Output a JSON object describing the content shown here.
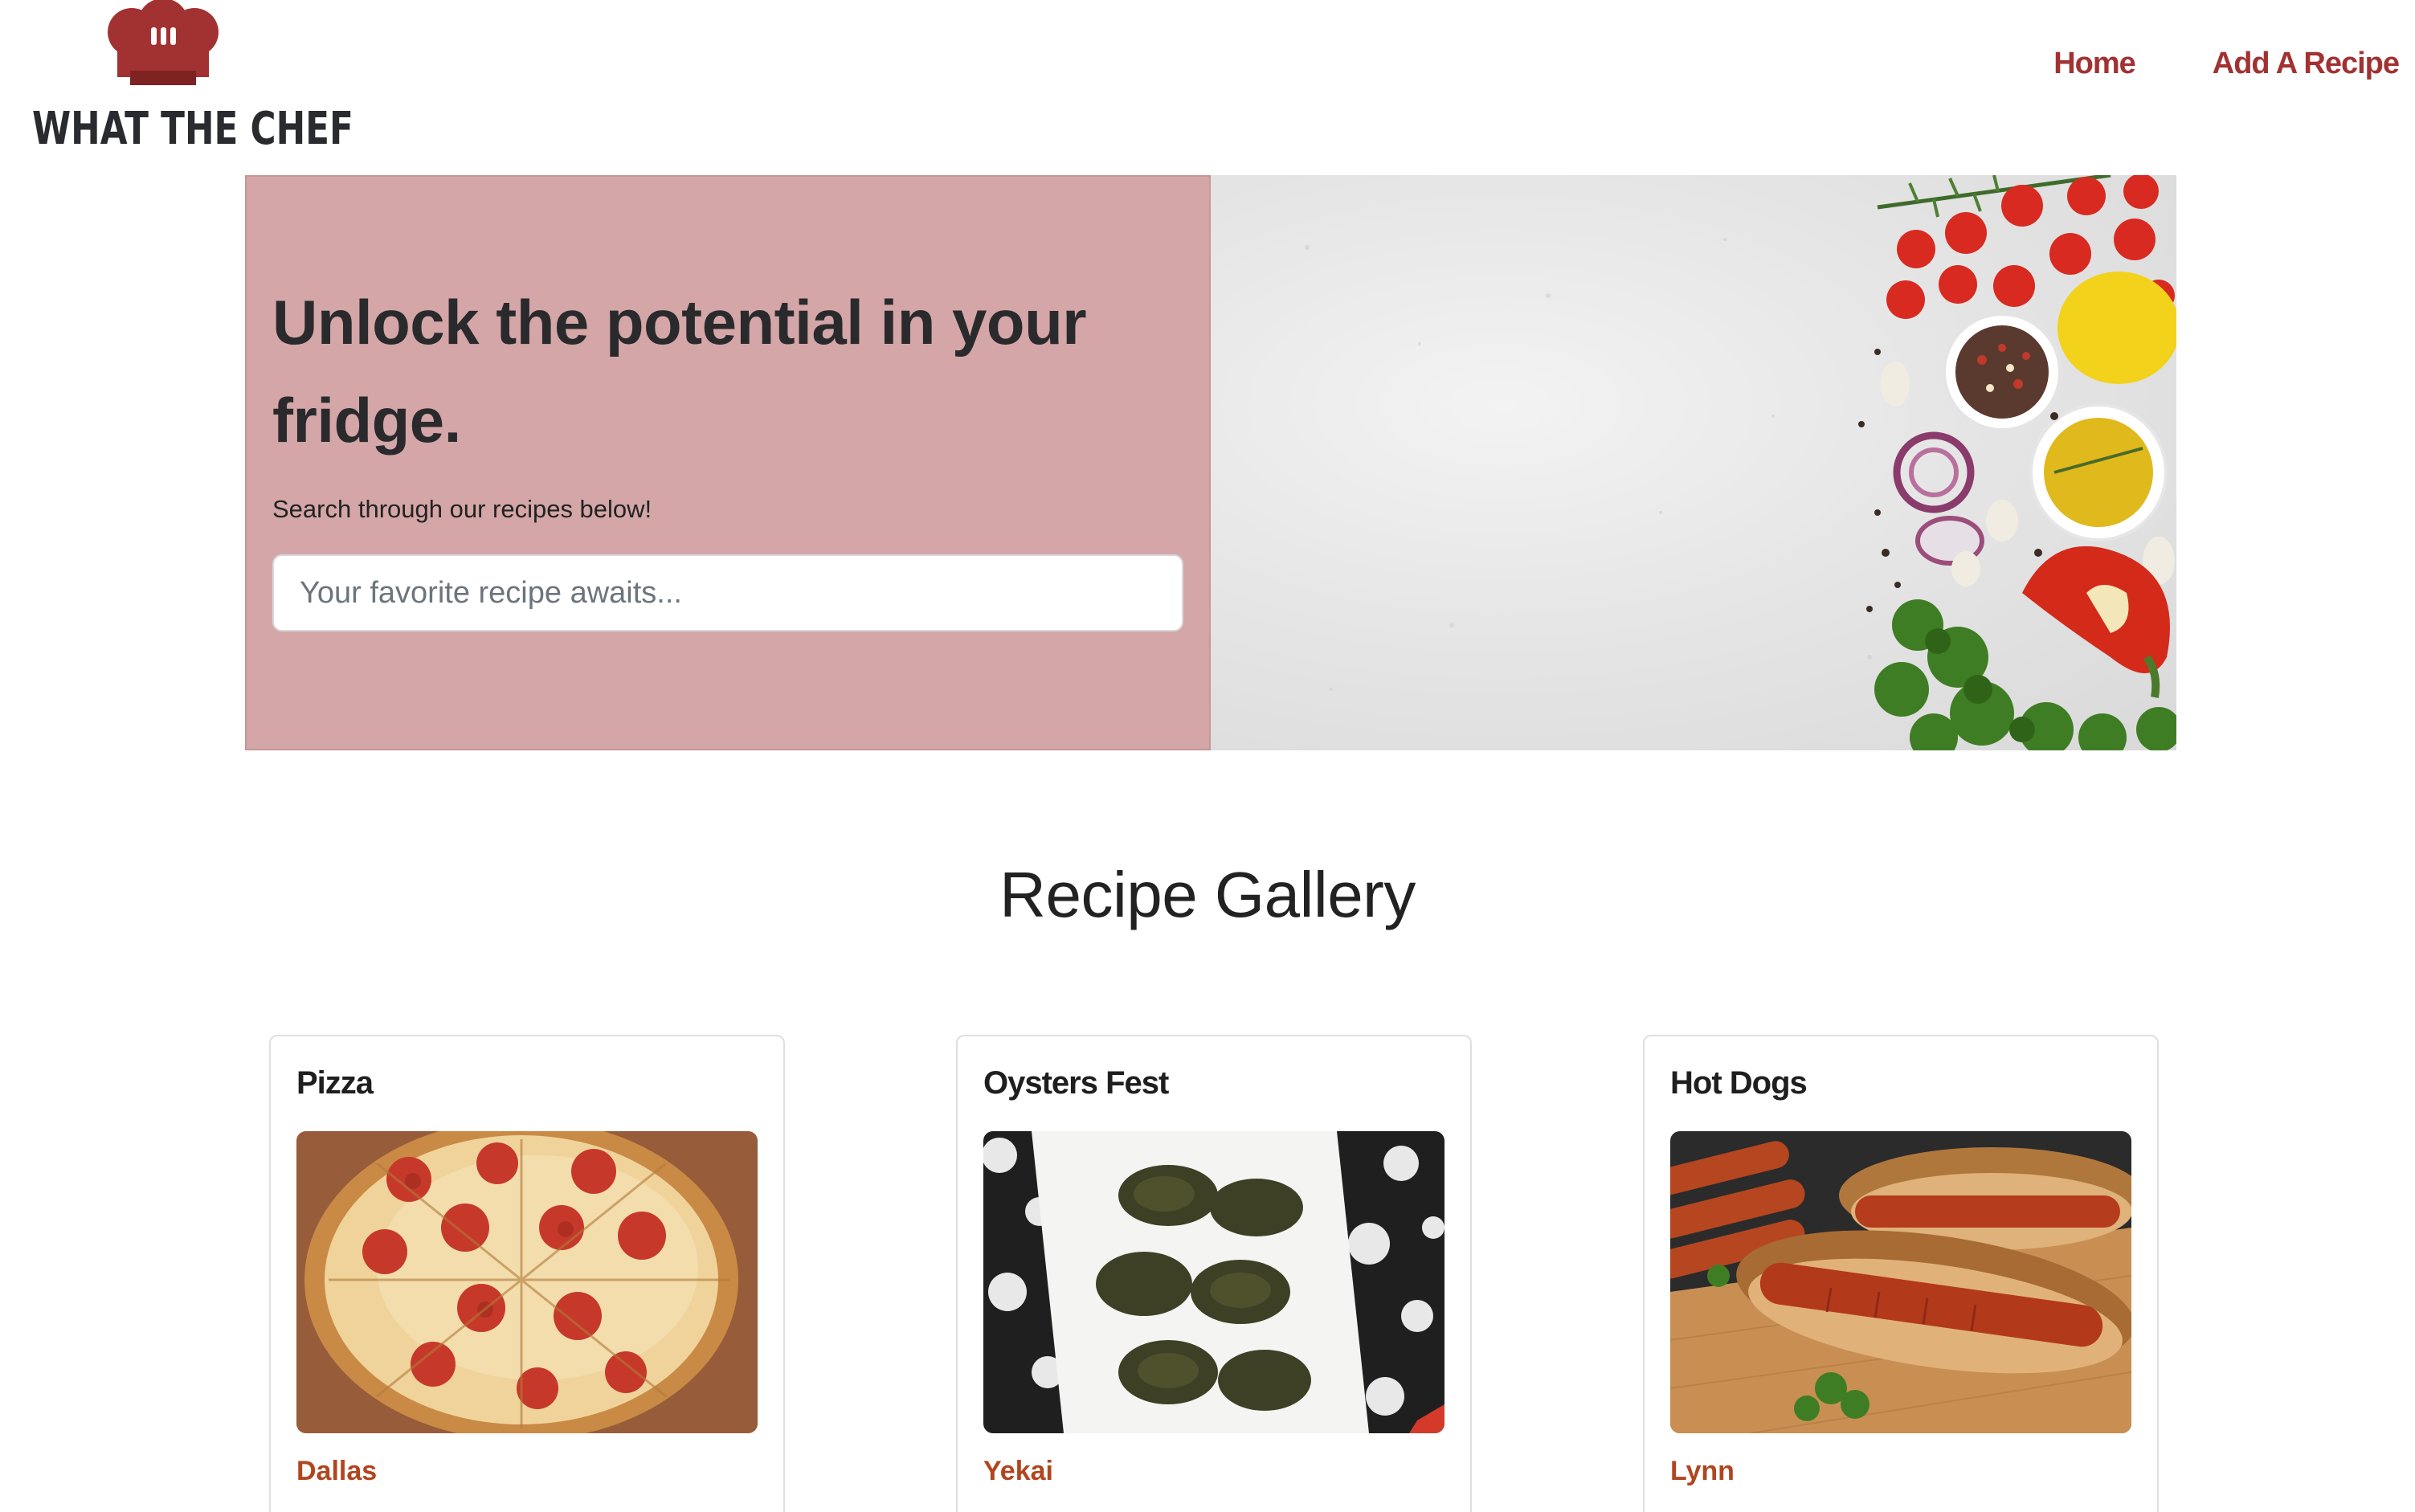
{
  "brand": {
    "name": "WHAT THE CHEF",
    "hat_color": "#a23232"
  },
  "nav": {
    "items": [
      {
        "label": "Home"
      },
      {
        "label": "Add A Recipe"
      }
    ],
    "link_color": "#a23232"
  },
  "hero": {
    "title": "Unlock the potential in your fridge.",
    "subtitle": "Search through our recipes below!",
    "search_placeholder": "Your favorite recipe awaits...",
    "search_value": "",
    "panel_color": "#d4a6a7"
  },
  "gallery": {
    "title": "Recipe Gallery",
    "cards": [
      {
        "title": "Pizza",
        "author": "Dallas",
        "image_icon": "pizza-image"
      },
      {
        "title": "Oysters Fest",
        "author": "Yekai",
        "image_icon": "oysters-image"
      },
      {
        "title": "Hot Dogs",
        "author": "Lynn",
        "image_icon": "hot-dogs-image"
      }
    ],
    "author_color": "#b0461f"
  }
}
